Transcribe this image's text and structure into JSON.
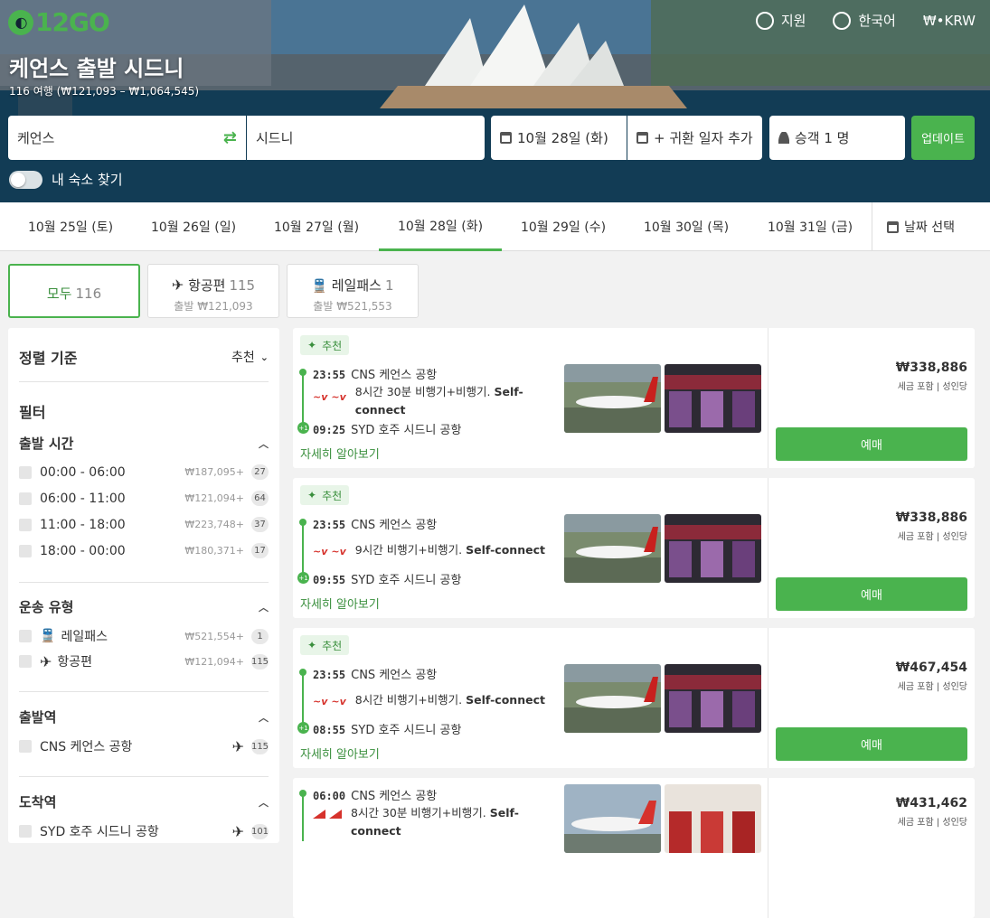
{
  "header": {
    "logo": "12GO",
    "nav": {
      "support": "지원",
      "language": "한국어",
      "currency": "₩•KRW"
    },
    "title": "케언스 출발 시드니",
    "subtitle": "116 여행 (₩121,093 – ₩1,064,545)"
  },
  "search": {
    "from": "케언스",
    "to": "시드니",
    "date": "10월 28일 (화)",
    "return": "+ 귀환 일자 추가",
    "passengers": "승객 1 명",
    "update": "업데이트",
    "toggle_label": "내 숙소 찾기"
  },
  "dates": [
    "10월 25일 (토)",
    "10월 26일 (일)",
    "10월 27일 (월)",
    "10월 28일 (화)",
    "10월 29일 (수)",
    "10월 30일 (목)",
    "10월 31일 (금)"
  ],
  "date_select": "날짜 선택",
  "mode_tabs": [
    {
      "label": "모두",
      "count": "116",
      "sub": ""
    },
    {
      "label": "항공편",
      "count": "115",
      "sub": "출발 ₩121,093"
    },
    {
      "label": "레일패스",
      "count": "1",
      "sub": "출발 ₩521,553"
    }
  ],
  "sidebar": {
    "sort_label": "정렬 기준",
    "sort_value": "추천",
    "filter_label": "필터",
    "departure_time": {
      "title": "출발 시간",
      "items": [
        {
          "label": "00:00 - 06:00",
          "price": "₩187,095+",
          "count": "27"
        },
        {
          "label": "06:00 - 11:00",
          "price": "₩121,094+",
          "count": "64"
        },
        {
          "label": "11:00 - 18:00",
          "price": "₩223,748+",
          "count": "37"
        },
        {
          "label": "18:00 - 00:00",
          "price": "₩180,371+",
          "count": "17"
        }
      ]
    },
    "transport": {
      "title": "운송 유형",
      "items": [
        {
          "label": "레일패스",
          "price": "₩521,554+",
          "count": "1"
        },
        {
          "label": "항공편",
          "price": "₩121,094+",
          "count": "115"
        }
      ]
    },
    "origin": {
      "title": "출발역",
      "items": [
        {
          "label": "CNS 케언스 공항",
          "count": "115"
        }
      ]
    },
    "destination": {
      "title": "도착역",
      "items": [
        {
          "label": "SYD 호주 시드니 공항",
          "count": "101"
        }
      ]
    }
  },
  "results": [
    {
      "tag": "추천",
      "dep_time": "23:55",
      "dep_station": "CNS 케언스 공항",
      "duration": "8시간 30분 비행기+비행기.",
      "self_connect": "Self-connect",
      "arr_time": "09:25",
      "arr_station": "SYD 호주 시드니 공항",
      "more": "자세히 알아보기",
      "price": "₩338,886",
      "tax": "세금 포함 | 성인당",
      "book": "예매",
      "airline": "virgin"
    },
    {
      "tag": "추천",
      "dep_time": "23:55",
      "dep_station": "CNS 케언스 공항",
      "duration": "9시간 비행기+비행기.",
      "self_connect": "Self-connect",
      "arr_time": "09:55",
      "arr_station": "SYD 호주 시드니 공항",
      "more": "자세히 알아보기",
      "price": "₩338,886",
      "tax": "세금 포함 | 성인당",
      "book": "예매",
      "airline": "virgin"
    },
    {
      "tag": "추천",
      "dep_time": "23:55",
      "dep_station": "CNS 케언스 공항",
      "duration": "8시간 비행기+비행기.",
      "self_connect": "Self-connect",
      "arr_time": "08:55",
      "arr_station": "SYD 호주 시드니 공항",
      "more": "자세히 알아보기",
      "price": "₩467,454",
      "tax": "세금 포함 | 성인당",
      "book": "예매",
      "airline": "virgin"
    },
    {
      "tag": "",
      "dep_time": "06:00",
      "dep_station": "CNS 케언스 공항",
      "duration": "8시간 30분 비행기+비행기.",
      "self_connect": "Self-connect",
      "arr_time": "",
      "arr_station": "",
      "more": "",
      "price": "₩431,462",
      "tax": "세금 포함 | 성인당",
      "book": "예매",
      "airline": "qantas"
    }
  ],
  "colors": {
    "accent": "#4ab34e",
    "hero_sky": "#3d6b91",
    "hero_water": "#0f3852"
  }
}
